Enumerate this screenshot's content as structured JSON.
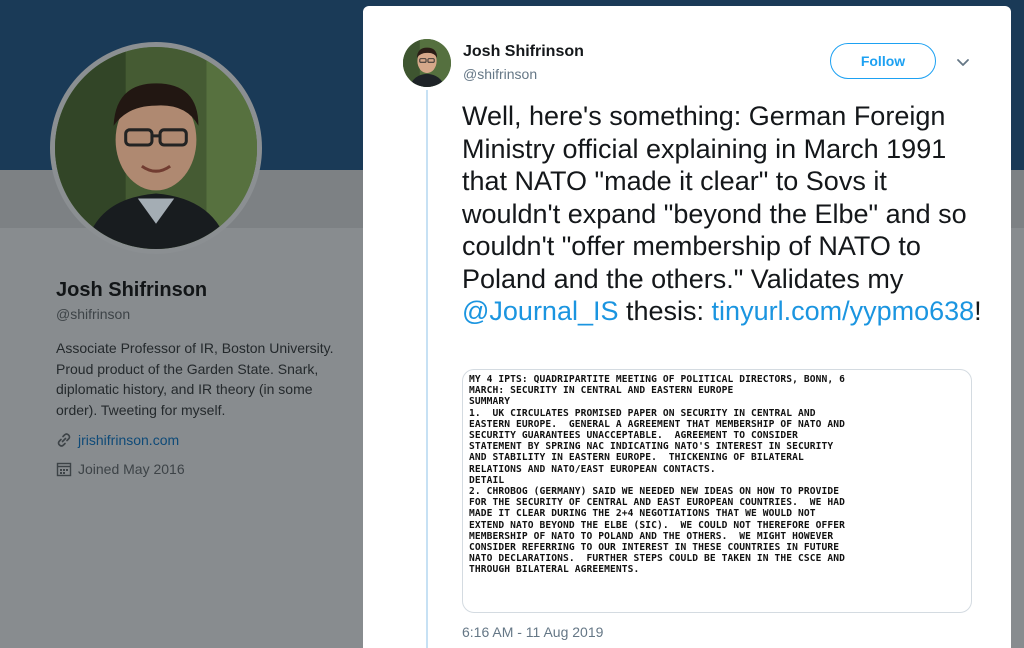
{
  "profile": {
    "name": "Josh Shifrinson",
    "handle": "@shifrinson",
    "bio": "Associate Professor of IR, Boston University. Proud product of the Garden State. Snark, diplomatic history, and IR theory (in some order). Tweeting for myself.",
    "website": "jrishifrinson.com",
    "joined": "Joined May 2016"
  },
  "tweet": {
    "author_name": "Josh Shifrinson",
    "author_handle": "@shifrinson",
    "follow_label": "Follow",
    "text_before_mention": "Well, here's something: German Foreign Ministry official explaining in March 1991 that NATO \"made it clear\" to Sovs it wouldn't expand \"beyond the Elbe\" and so couldn't \"offer membership of NATO to Poland and the others.\" Validates  my ",
    "mention": "@Journal_IS",
    "text_between": " thesis: ",
    "url": "tinyurl.com/yypmo638",
    "text_after_url": "!",
    "timestamp": "6:16 AM - 11 Aug 2019",
    "document_lines": [
      "MY 4 IPTS: QUADRIPARTITE MEETING OF POLITICAL DIRECTORS, BONN, 6",
      "MARCH: SECURITY IN CENTRAL AND EASTERN EUROPE",
      "SUMMARY",
      "1.  UK CIRCULATES PROMISED PAPER ON SECURITY IN CENTRAL AND",
      "EASTERN EUROPE.  GENERAL A AGREEMENT THAT MEMBERSHIP OF NATO AND",
      "SECURITY GUARANTEES UNACCEPTABLE.  AGREEMENT TO CONSIDER",
      "STATEMENT BY SPRING NAC INDICATING NATO'S INTEREST IN SECURITY",
      "AND STABILITY IN EASTERN EUROPE.  THICKENING OF BILATERAL",
      "RELATIONS AND NATO/EAST EUROPEAN CONTACTS.",
      "DETAIL",
      "2. CHROBOG (GERMANY) SAID WE NEEDED NEW IDEAS ON HOW TO PROVIDE",
      "FOR THE SECURITY OF CENTRAL AND EAST EUROPEAN COUNTRIES.  WE HAD",
      "MADE IT CLEAR DURING THE 2+4 NEGOTIATIONS THAT WE WOULD NOT",
      "EXTEND NATO BEYOND THE ELBE (SIC).  WE COULD NOT THEREFORE OFFER",
      "MEMBERSHIP OF NATO TO POLAND AND THE OTHERS.  WE MIGHT HOWEVER",
      "CONSIDER REFERRING TO OUR INTEREST IN THESE COUNTRIES IN FUTURE",
      "NATO DECLARATIONS.  FURTHER STEPS COULD BE TAKEN IN THE CSCE AND",
      "THROUGH BILATERAL AGREEMENTS."
    ]
  },
  "icons": {
    "website": "link-icon",
    "joined": "calendar-icon",
    "caret": "chevron-down-icon"
  },
  "colors": {
    "accent": "#1da1f2",
    "link": "#1b95e0",
    "secondary_text": "#657786",
    "thread_line": "#c7e1f4"
  }
}
